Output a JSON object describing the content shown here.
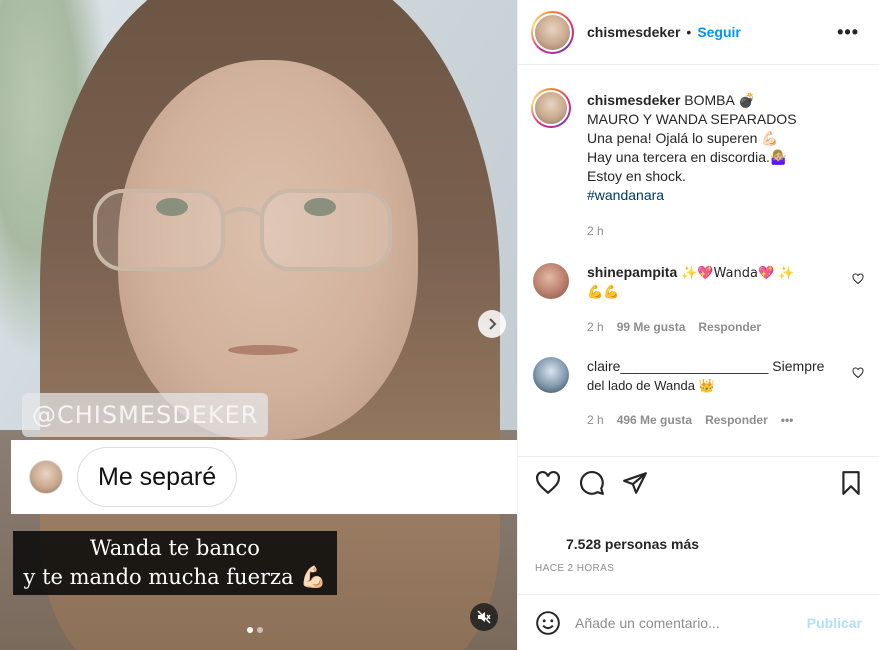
{
  "media": {
    "watermark": "@CHISMESDEKER",
    "reply_bubble": "Me separé",
    "caption_line1": "Wanda te banco",
    "caption_line2": "y te mando mucha fuerza 💪🏻"
  },
  "header": {
    "username": "chismesdeker",
    "separator": "•",
    "follow_label": "Seguir",
    "more_label": "•••"
  },
  "post_caption": {
    "username": "chismesdeker",
    "lines": [
      "BOMBA 💣",
      "MAURO Y WANDA SEPARADOS",
      "Una pena! Ojalá lo superen 💪🏻",
      "Hay una tercera en discordia.🤷🏼‍♀️",
      "Estoy en shock."
    ],
    "hashtag": "#wandanara",
    "time": "2 h"
  },
  "comments": [
    {
      "username": "shinepampita",
      "text_line1": "✨💖Wanda💖 ✨",
      "text_line2": "💪💪",
      "time": "2 h",
      "likes": "99 Me gusta",
      "reply_label": "Responder"
    },
    {
      "username": "claire___________________",
      "text_line1": "Siempre",
      "text_line2": "del lado de Wanda 👑",
      "time": "2 h",
      "likes": "496 Me gusta",
      "reply_label": "Responder",
      "more_label": "•••"
    }
  ],
  "stats": {
    "likes": "7.528 personas más",
    "posted_ago": "HACE 2 HORAS"
  },
  "add_comment": {
    "placeholder": "Añade un comentario...",
    "post_label": "Publicar"
  },
  "colors": {
    "link_blue": "#0095f6",
    "hashtag": "#00376b",
    "meta_gray": "#8e8e8e",
    "publish_disabled": "#b2dffc"
  },
  "icons": [
    "heart-icon",
    "comment-icon",
    "share-icon",
    "bookmark-icon",
    "emoji-icon",
    "mute-icon",
    "chevron-right-icon"
  ]
}
